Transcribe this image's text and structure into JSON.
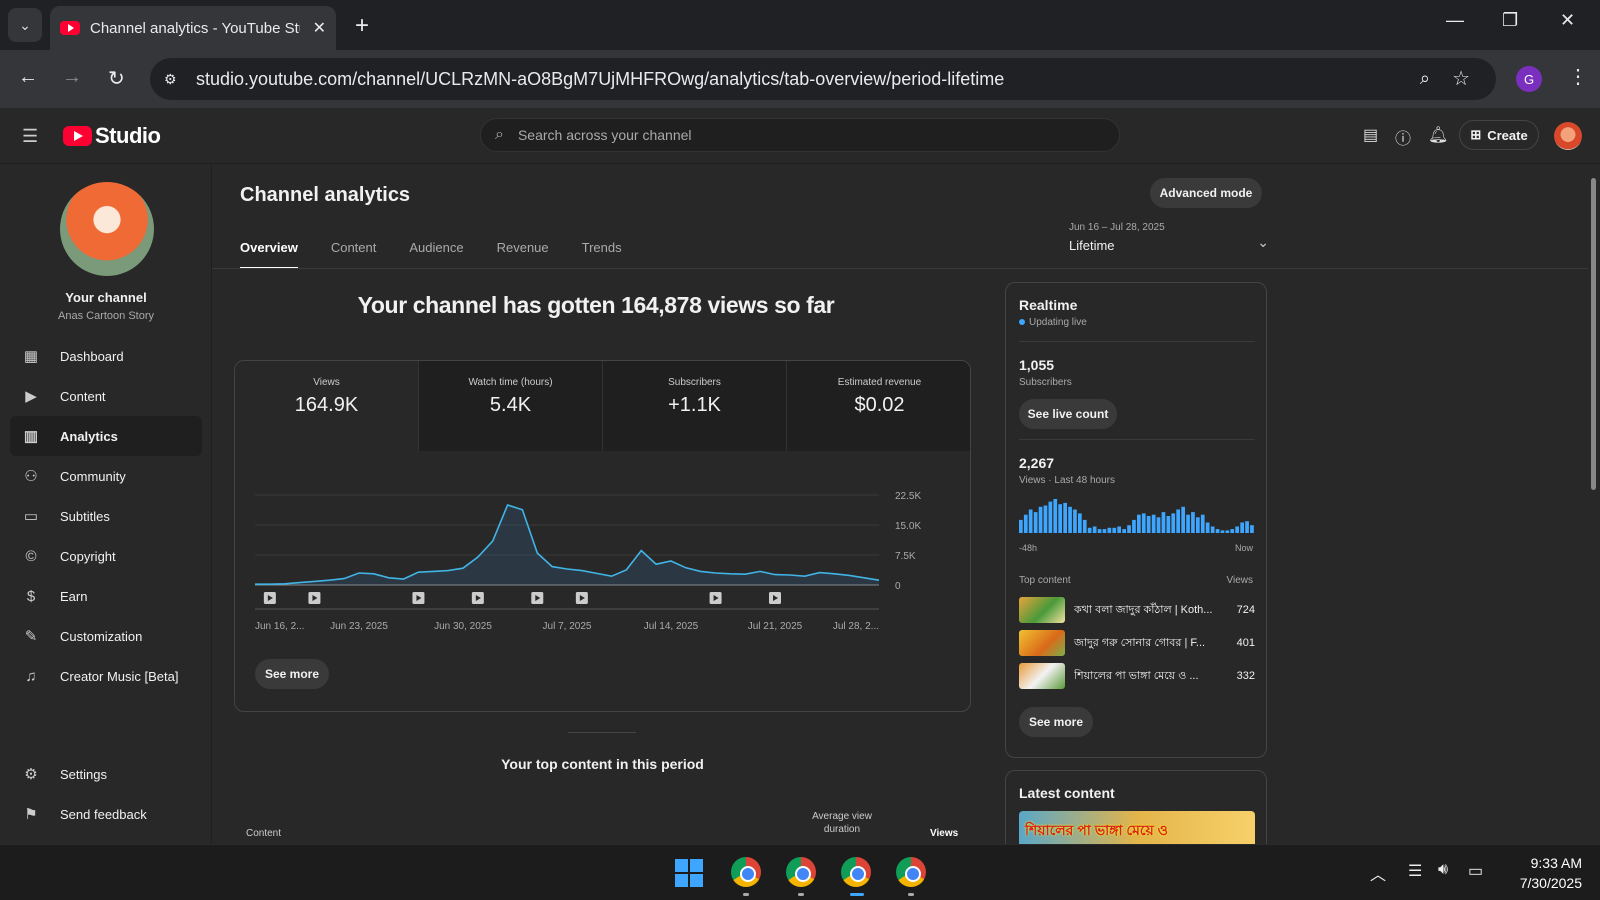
{
  "browser": {
    "tab_title": "Channel analytics - YouTube Studio",
    "tab_close": "✕",
    "new_tab": "+",
    "url": "studio.youtube.com/channel/UCLRzMN-aO8BgM7UjMHFROwg/analytics/tab-overview/period-lifetime",
    "profile_initial": "G"
  },
  "header": {
    "logo_text": "Studio",
    "search_placeholder": "Search across your channel",
    "create_label": "Create"
  },
  "sidebar": {
    "channel_title": "Your channel",
    "channel_name": "Anas Cartoon Story",
    "items": [
      {
        "label": "Dashboard",
        "icon": "dashboard-icon"
      },
      {
        "label": "Content",
        "icon": "content-icon"
      },
      {
        "label": "Analytics",
        "icon": "analytics-icon",
        "active": true
      },
      {
        "label": "Community",
        "icon": "community-icon"
      },
      {
        "label": "Subtitles",
        "icon": "subtitles-icon"
      },
      {
        "label": "Copyright",
        "icon": "copyright-icon"
      },
      {
        "label": "Earn",
        "icon": "earn-icon"
      },
      {
        "label": "Customization",
        "icon": "customization-icon"
      },
      {
        "label": "Creator Music [Beta]",
        "icon": "creator-music-icon"
      }
    ],
    "bottom_items": [
      {
        "label": "Settings",
        "icon": "settings-icon"
      },
      {
        "label": "Send feedback",
        "icon": "feedback-icon"
      }
    ]
  },
  "main": {
    "page_title": "Channel analytics",
    "advanced_mode_label": "Advanced mode",
    "tabs": [
      {
        "label": "Overview",
        "active": true
      },
      {
        "label": "Content"
      },
      {
        "label": "Audience"
      },
      {
        "label": "Revenue"
      },
      {
        "label": "Trends"
      }
    ],
    "period": {
      "range": "Jun 16 – Jul 28, 2025",
      "value": "Lifetime"
    },
    "headline": "Your channel has gotten 164,878 views so far",
    "metrics": [
      {
        "label": "Views",
        "value": "164.9K"
      },
      {
        "label": "Watch time (hours)",
        "value": "5.4K"
      },
      {
        "label": "Subscribers",
        "value": "+1.1K"
      },
      {
        "label": "Estimated revenue",
        "value": "$0.02"
      }
    ],
    "see_more_label": "See more",
    "top_content_title": "Your top content in this period",
    "top_content_columns": {
      "content": "Content",
      "avg_duration": "Average view duration",
      "views": "Views"
    }
  },
  "chart_data": {
    "type": "area",
    "title": "",
    "x_tick_labels": [
      "Jun 16, 2...",
      "Jun 23, 2025",
      "Jun 30, 2025",
      "Jul 7, 2025",
      "Jul 14, 2025",
      "Jul 21, 2025",
      "Jul 28, 2..."
    ],
    "y_tick_labels": [
      "22.5K",
      "15.0K",
      "7.5K",
      "0"
    ],
    "ylim": [
      0,
      22500
    ],
    "x_day_labels": [
      "Jun 16",
      "Jun 17",
      "Jun 18",
      "Jun 19",
      "Jun 20",
      "Jun 21",
      "Jun 22",
      "Jun 23",
      "Jun 24",
      "Jun 25",
      "Jun 26",
      "Jun 27",
      "Jun 28",
      "Jun 29",
      "Jun 30",
      "Jul 1",
      "Jul 2",
      "Jul 3",
      "Jul 4",
      "Jul 5",
      "Jul 6",
      "Jul 7",
      "Jul 8",
      "Jul 9",
      "Jul 10",
      "Jul 11",
      "Jul 12",
      "Jul 13",
      "Jul 14",
      "Jul 15",
      "Jul 16",
      "Jul 17",
      "Jul 18",
      "Jul 19",
      "Jul 20",
      "Jul 21",
      "Jul 22",
      "Jul 23",
      "Jul 24",
      "Jul 25",
      "Jul 26",
      "Jul 27",
      "Jul 28"
    ],
    "values": [
      200,
      200,
      300,
      600,
      900,
      1200,
      1600,
      3000,
      2800,
      1800,
      1500,
      3200,
      3400,
      3600,
      4200,
      7000,
      11000,
      20000,
      18800,
      8000,
      4600,
      4000,
      3600,
      2900,
      2200,
      3800,
      8600,
      5200,
      6000,
      4300,
      3400,
      3000,
      2800,
      2700,
      3400,
      2600,
      2500,
      2200,
      3100,
      2800,
      2400,
      1800,
      1200
    ],
    "upload_markers": [
      "Jun 17",
      "Jun 20",
      "Jun 27",
      "Jul 1",
      "Jul 5",
      "Jul 8",
      "Jul 17",
      "Jul 21"
    ]
  },
  "realtime": {
    "title": "Realtime",
    "status": "Updating live",
    "subscribers_value": "1,055",
    "subscribers_label": "Subscribers",
    "live_count_label": "See live count",
    "views_value": "2,267",
    "views_label": "Views · Last 48 hours",
    "axis_start": "-48h",
    "axis_end": "Now",
    "hourly_views": [
      10,
      14,
      18,
      16,
      20,
      21,
      24,
      26,
      22,
      23,
      20,
      18,
      15,
      10,
      4,
      5,
      3,
      3,
      4,
      4,
      5,
      3,
      6,
      10,
      14,
      15,
      13,
      14,
      12,
      16,
      13,
      15,
      18,
      20,
      14,
      16,
      12,
      14,
      8,
      5,
      3,
      2,
      2,
      3,
      5,
      8,
      9,
      6
    ],
    "top_content_label": "Top content",
    "views_col": "Views",
    "top_items": [
      {
        "title": "কথা বলা জাদুর কাঁঠাল | Koth...",
        "views": "724"
      },
      {
        "title": "জাদুর গরু সোনার গোবর | F...",
        "views": "401"
      },
      {
        "title": "শিয়ালের পা ভাঙ্গা মেয়ে ও ...",
        "views": "332"
      }
    ],
    "see_more_label": "See more"
  },
  "latest": {
    "title": "Latest content",
    "thumb_text": "শিয়ালের পা ভাঙ্গা মেয়ে ও"
  },
  "taskbar": {
    "time": "9:33 AM",
    "date": "7/30/2025"
  },
  "colors": {
    "accent_blue": "#3ea6ff",
    "youtube_red": "#ff0033",
    "background": "#282828"
  }
}
